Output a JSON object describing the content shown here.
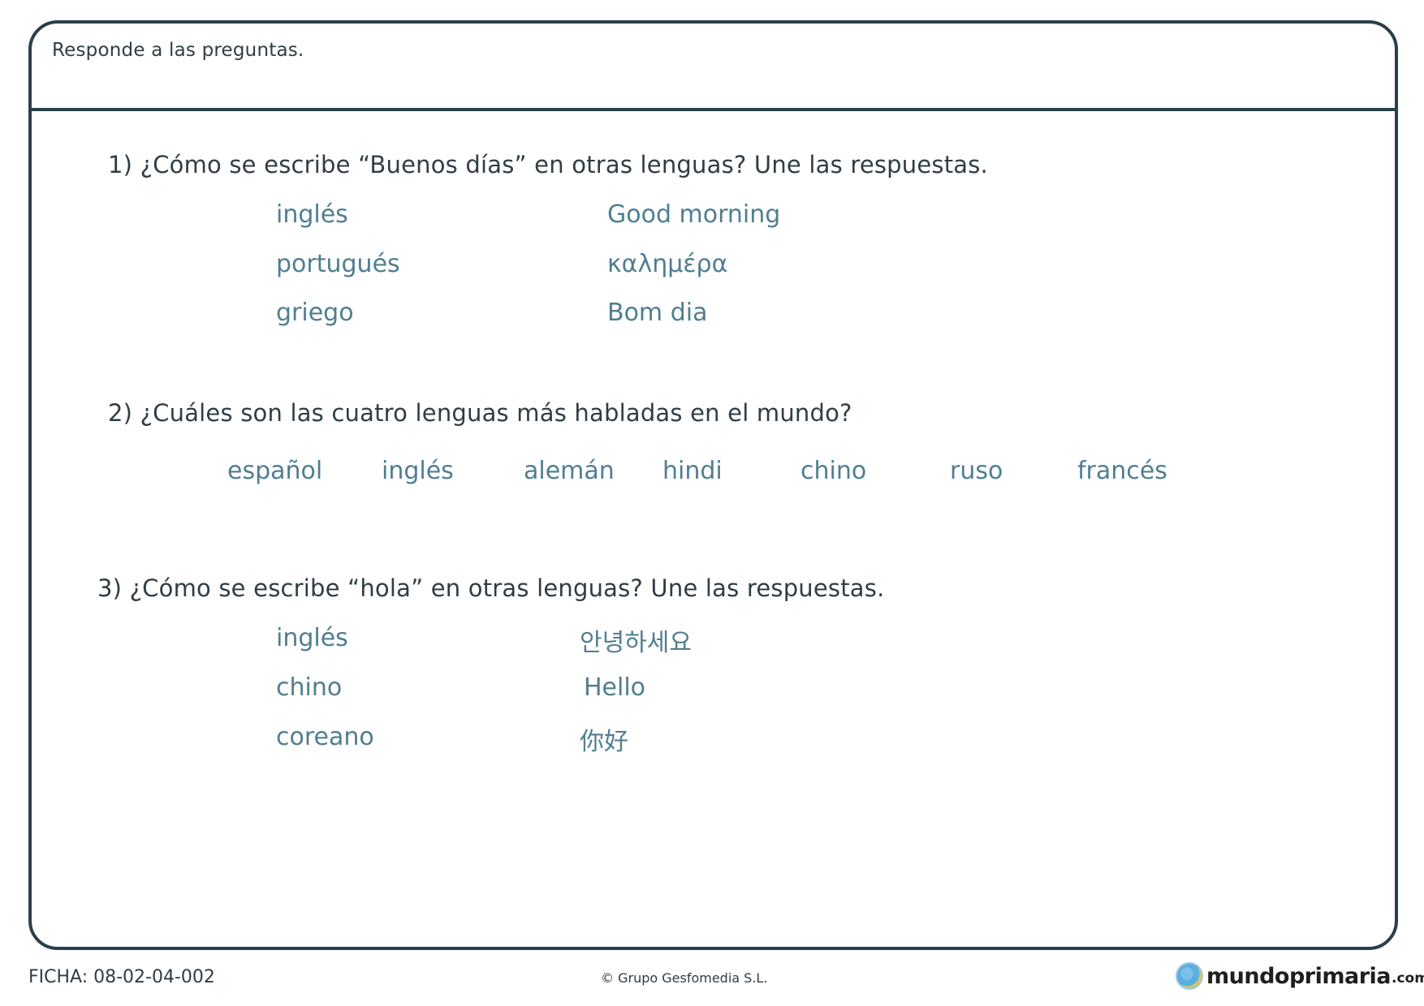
{
  "instruction": "Responde a las preguntas.",
  "questions": [
    {
      "number": "1)",
      "text": "1) ¿Cómo se escribe “Buenos días” en otras lenguas? Une las respuestas.",
      "left_column": [
        "inglés",
        "portugués",
        "griego"
      ],
      "right_column": [
        "Good morning",
        "καλημέρα",
        "Bom dia"
      ]
    },
    {
      "number": "2)",
      "text": "2) ¿Cuáles son las cuatro lenguas más habladas en el mundo?",
      "options": [
        "español",
        "inglés",
        "alemán",
        "hindi",
        "chino",
        "ruso",
        "francés"
      ]
    },
    {
      "number": "3)",
      "text": "3) ¿Cómo se escribe “hola” en otras lenguas? Une las respuestas.",
      "left_column": [
        "inglés",
        "chino",
        "coreano"
      ],
      "right_column": [
        "안녕하세요",
        "Hello",
        "你好"
      ]
    }
  ],
  "footer": {
    "ficha": "FICHA: 08-02-04-002",
    "copyright": "© Grupo Gesfomedia S.L.",
    "logo_name": "mundoprimaria",
    "logo_tld": ".com"
  },
  "colors": {
    "border": "#2b3f4a",
    "question_text": "#2f3d45",
    "answer_text": "#507e90"
  }
}
